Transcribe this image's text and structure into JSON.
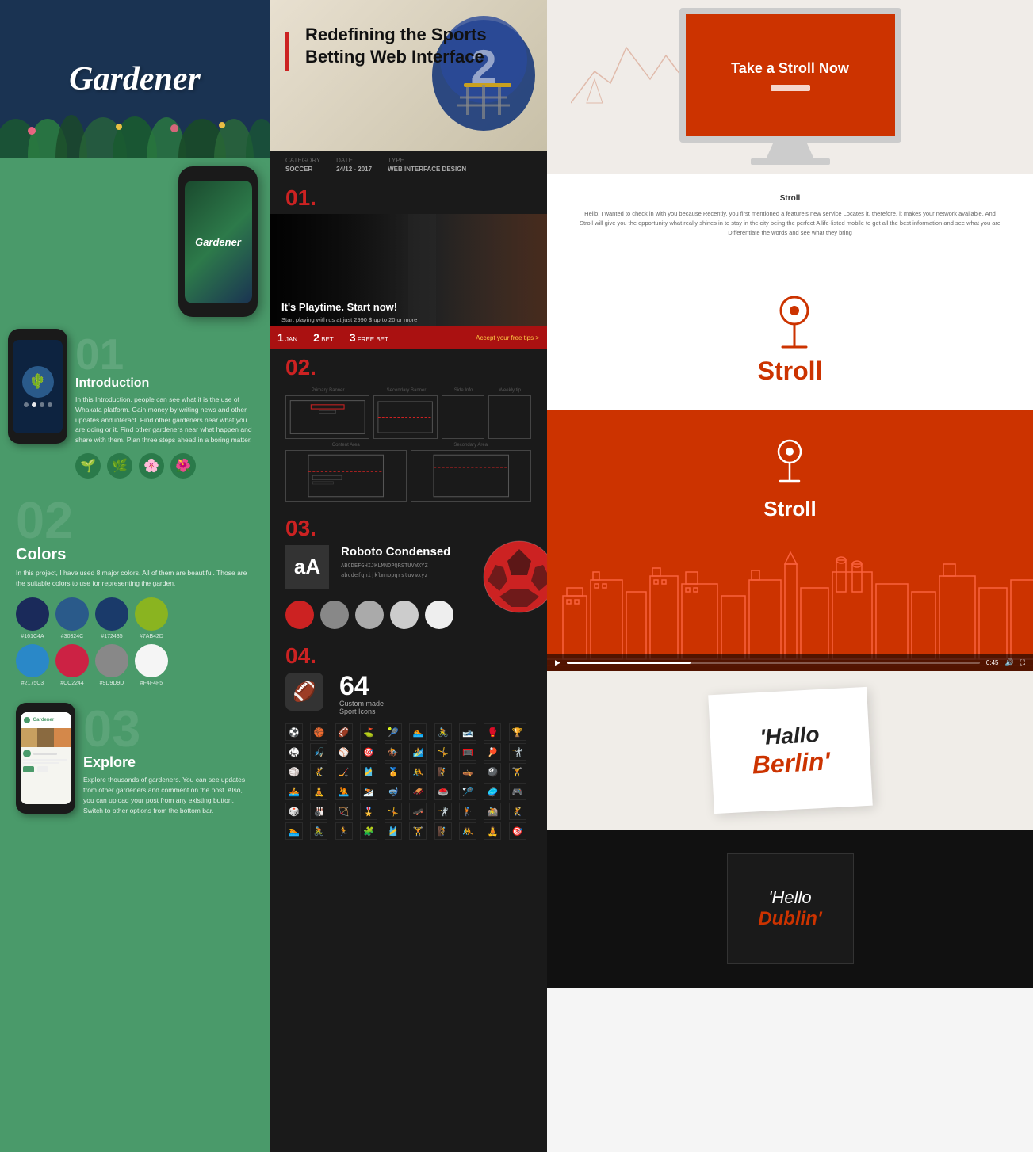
{
  "left": {
    "title": "Gardener",
    "phoneScreenText": "Gardener",
    "section01": {
      "number": "01",
      "title": "Introduction",
      "desc": "In this Introduction, people can see what it is the use of Whakata platform. Gain money by writing news and other updates and interact. Find other gardeners near what you are doing or it. Find other gardeners near what happen and share with them. Plan three steps ahead in a boring matter.",
      "icons": [
        "🌱",
        "🌿",
        "🌸",
        "🌺"
      ]
    },
    "section02": {
      "number": "02",
      "title": "Colors",
      "desc": "In this project, I have used 8 major colors. All of them are beautiful. Those are the suitable colors to use for representing the garden.",
      "swatches": [
        {
          "color": "#1a2a5a",
          "label": "#161C4A"
        },
        {
          "color": "#2a5a8a",
          "label": "#30324C"
        },
        {
          "color": "#1a3a6a",
          "label": "#172435"
        },
        {
          "color": "#8ab420",
          "label": "#7AB42D"
        },
        {
          "color": "#2a88c8",
          "label": "#2175C3"
        },
        {
          "color": "#cc2244",
          "label": "#CC2244"
        },
        {
          "color": "#888888",
          "label": "#9D9D9D"
        },
        {
          "color": "#f5f5f5",
          "label": "#F4F4F5"
        }
      ]
    },
    "section03": {
      "number": "03",
      "title": "Explore",
      "desc": "Explore thousands of gardeners. You can see updates from other gardeners and comment on the post. Also, you can upload your post from any existing button. Switch to other options from the bottom bar."
    }
  },
  "middle": {
    "title": "Redefining the Sports Betting Web Interface",
    "meta": {
      "category": "SOCCER",
      "date": "24/12 - 2017",
      "type": "WEB INTERFACE DESIGN"
    },
    "section01": {
      "number": "01.",
      "heroText": "It's Playtime. Start now!",
      "heroSub": "Start playing with us at just 2990 $ up to 20 or more",
      "bets": [
        {
          "num": "1",
          "label": "JAN",
          "odds": ""
        },
        {
          "num": "2",
          "label": "BET",
          "odds": ""
        },
        {
          "num": "3",
          "label": "FREE BET",
          "odds": ""
        }
      ]
    },
    "section02": {
      "number": "02.",
      "wireframes": {
        "topLabels": [
          "Primary Banner",
          "Secondary Banner",
          "Side Info",
          "Weekly tip"
        ],
        "bottomLabels": [
          "Content Area",
          "Secondary Area"
        ]
      }
    },
    "section03": {
      "number": "03.",
      "font": {
        "sample": "aA",
        "name": "Roboto Condensed",
        "chars": "ABCDEFGHIJKLMNOPQRSTUVWXYZ\nabcdefghijklmnopqrstuvwxyz"
      },
      "colors": [
        "#cc2222",
        "#888",
        "#aaa",
        "#ccc",
        "#eee"
      ]
    },
    "section04": {
      "number": "04.",
      "iconCount": "64",
      "iconLabel": "Custom made",
      "iconSublabel": "Sport Icons"
    }
  },
  "right": {
    "hero": {
      "monitorText": "Take a\nStroll Now",
      "btnLabel": ""
    },
    "letter": {
      "title": "Stroll",
      "body": "Hello! I wanted to check in with you because\nRecently, you first mentioned a feature's new service\nLocates it, therefore, it makes your network available.\n\nAnd Stroll will give you the opportunity\nwhat really shines in to stay in the city being the perfect\nA life-listed mobile to get all the best information and see what you are\nDifferentiate the words and see what they bring"
    },
    "logoSection": {
      "text": "Stroll"
    },
    "orangeSection": {
      "text": "Stroll"
    },
    "cityscapeSection": {},
    "berlinSection": {
      "hello": "'Hallo",
      "city": "Berlin'"
    },
    "dublinSection": {
      "hello": "'Hello",
      "city": "Dublin'"
    }
  }
}
